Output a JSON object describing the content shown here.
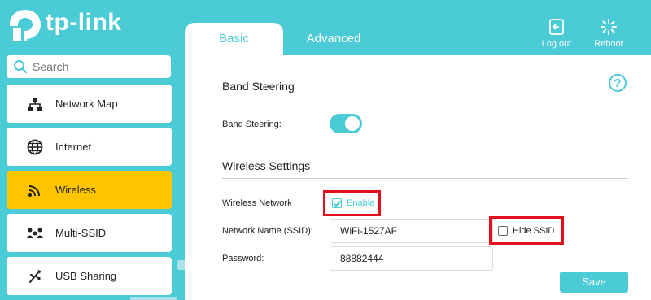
{
  "brand": {
    "name": "tp-link"
  },
  "header": {
    "logout_label": "Log out",
    "reboot_label": "Reboot"
  },
  "tabs": [
    {
      "label": "Basic",
      "active": true
    },
    {
      "label": "Advanced",
      "active": false
    }
  ],
  "sidebar": {
    "search_placeholder": "Search",
    "items": [
      {
        "label": "Network Map",
        "icon": "network-map-icon"
      },
      {
        "label": "Internet",
        "icon": "globe-icon"
      },
      {
        "label": "Wireless",
        "icon": "wifi-icon",
        "active": true
      },
      {
        "label": "Multi-SSID",
        "icon": "multi-user-icon"
      },
      {
        "label": "USB Sharing",
        "icon": "usb-icon"
      }
    ]
  },
  "band_steering": {
    "title": "Band Steering",
    "label": "Band Steering:",
    "enabled": true
  },
  "wireless": {
    "title": "Wireless Settings",
    "network_label": "Wireless Network",
    "enable_label": "Enable",
    "enable_checked": true,
    "ssid_label": "Network Name (SSID):",
    "ssid_value": "WiFi-1527AF",
    "hide_ssid_label": "Hide SSID",
    "hide_ssid_checked": false,
    "password_label": "Password:",
    "password_value": "88882444"
  },
  "actions": {
    "save_label": "Save"
  },
  "colors": {
    "accent": "#4acbd6",
    "active_nav": "#ffc600",
    "highlight": "#e2101c"
  }
}
